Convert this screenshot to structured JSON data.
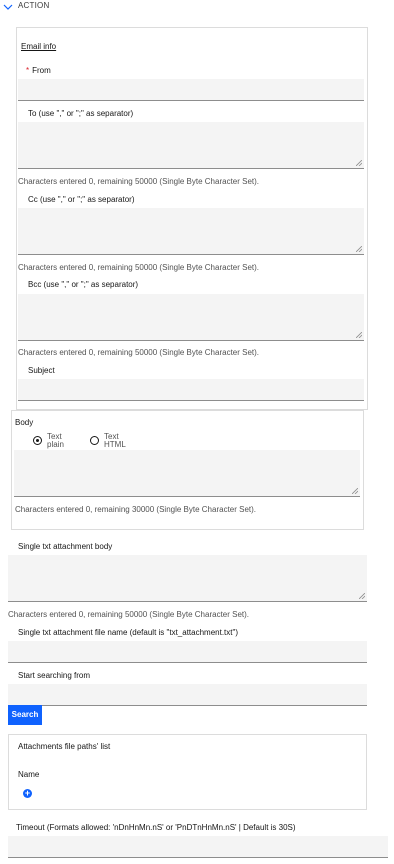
{
  "section": {
    "title": "ACTION"
  },
  "email_info": {
    "title": "Email info",
    "from": {
      "required_mark": "*",
      "label": "From",
      "value": ""
    },
    "to": {
      "label": "To (use \",\" or \";\" as separator)",
      "value": "",
      "helper": "Characters entered 0, remaining 50000 (Single Byte Character Set)."
    },
    "cc": {
      "label": "Cc (use \",\" or \";\" as separator)",
      "value": "",
      "helper": "Characters entered 0, remaining 50000 (Single Byte Character Set)."
    },
    "bcc": {
      "label": "Bcc (use \",\" or \";\" as separator)",
      "value": "",
      "helper": "Characters entered 0, remaining 50000 (Single Byte Character Set)."
    },
    "subject": {
      "label": "Subject",
      "value": ""
    }
  },
  "body": {
    "label": "Body",
    "options": [
      {
        "line1": "Text",
        "line2": "plain",
        "selected": true
      },
      {
        "line1": "Text",
        "line2": "HTML",
        "selected": false
      }
    ],
    "value": "",
    "helper": "Characters entered 0, remaining 30000 (Single Byte Character Set)."
  },
  "attachment_body": {
    "label": "Single txt attachment body",
    "value": "",
    "helper": "Characters entered 0, remaining 50000 (Single Byte Character Set)."
  },
  "attachment_name": {
    "label": "Single txt attachment file name (default is \"txt_attachment.txt\")",
    "value": ""
  },
  "start_searching": {
    "label": "Start searching from",
    "value": ""
  },
  "search_button": {
    "label": "Search"
  },
  "attachments_list": {
    "title": "Attachments file paths' list",
    "column": "Name"
  },
  "timeout": {
    "label": "Timeout (Formats allowed: 'nDnHnMn.nS' or 'PnDTnHnMn.nS' | Default is 30S)",
    "value": ""
  },
  "colors": {
    "accent": "#0f62fe",
    "field_bg": "#f4f4f4",
    "required": "#da1e28"
  },
  "icons": {
    "section_toggle": "chevron-down-icon",
    "add": "add-circle-icon"
  }
}
